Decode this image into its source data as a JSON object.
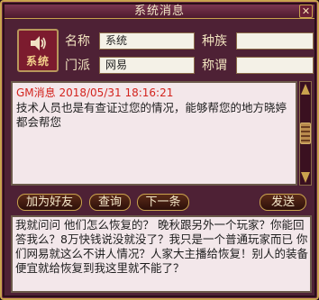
{
  "window": {
    "title": "系统消息",
    "close_label": "✕"
  },
  "sender": {
    "avatar_label": "系统",
    "name_label": "名称",
    "name_value": "系统",
    "race_label": "种族",
    "race_value": "",
    "sect_label": "门派",
    "sect_value": "网易",
    "title_label": "称谓",
    "title_value": ""
  },
  "message": {
    "header": "GM消息  2018/05/31 18:16:21",
    "body": "技术人员也是有查证过您的情况，能够帮您的地方晓婷都会帮您"
  },
  "buttons": {
    "add_friend": "加为好友",
    "query": "查询",
    "next": "下一条",
    "send": "发送"
  },
  "input": {
    "text": "我就问问  他们怎么恢复的？ 晚秋跟另外一个玩家？你能回答我么？8万快钱说没就没了？我只是一个普通玩家而已 你们网易就这么不讲人情况？人家大主播给恢复！别人的装备便宜就给恢复到我这里就不能了？"
  },
  "colors": {
    "frame": "#4e2135",
    "border_gold": "#c9a24e",
    "gm_red": "#d3241e",
    "panel_bg": "#f3e7ea"
  }
}
